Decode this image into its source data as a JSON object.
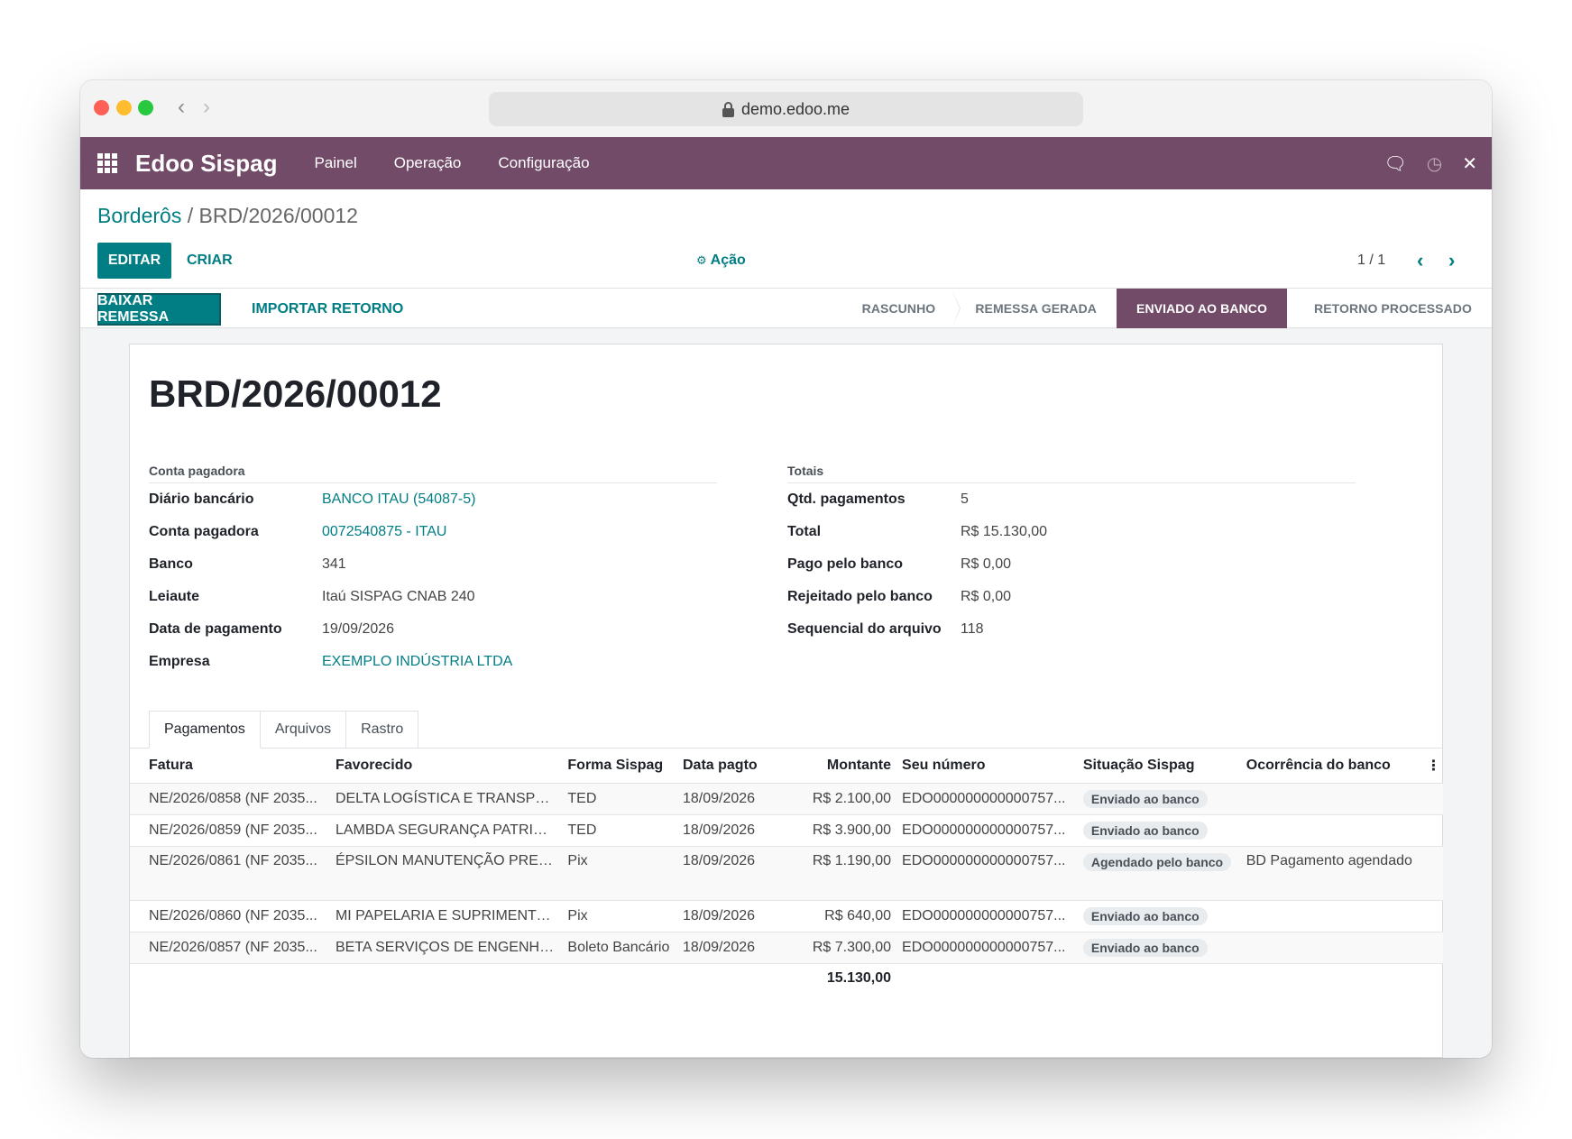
{
  "browser": {
    "url": "demo.edoo.me",
    "back_icon": "chevron-left",
    "forward_icon": "chevron-right"
  },
  "appbar": {
    "brand": "Edoo Sispag",
    "menu": [
      "Painel",
      "Operação",
      "Configuração"
    ],
    "bg_color": "#714b67"
  },
  "breadcrumb": {
    "parent": "Borderôs",
    "separator": "/",
    "current": "BRD/2026/00012"
  },
  "toolbar": {
    "edit_label": "EDITAR",
    "create_label": "CRIAR",
    "action_label": "Ação",
    "pager": "1 / 1"
  },
  "statusbar": {
    "download_label": "BAIXAR REMESSA",
    "import_label": "IMPORTAR RETORNO",
    "steps": [
      "RASCUNHO",
      "REMESSA GERADA",
      "ENVIADO AO BANCO",
      "RETORNO PROCESSADO"
    ],
    "active_step": "ENVIADO AO BANCO"
  },
  "record": {
    "title": "BRD/2026/00012",
    "left_group": {
      "title": "Conta pagadora",
      "fields": [
        {
          "label": "Diário bancário",
          "value": "BANCO ITAU (54087-5)"
        },
        {
          "label": "Conta pagadora",
          "value": "0072540875 - ITAU"
        },
        {
          "label": "Banco",
          "value": "341"
        },
        {
          "label": "Leiaute",
          "value": "Itaú SISPAG CNAB 240"
        },
        {
          "label": "Data de pagamento",
          "value": "19/09/2026"
        },
        {
          "label": "Empresa",
          "value": "EXEMPLO INDÚSTRIA LTDA"
        }
      ]
    },
    "right_group": {
      "title": "Totais",
      "fields": [
        {
          "label": "Qtd. pagamentos",
          "value": "5"
        },
        {
          "label": "Total",
          "value": "R$ 15.130,00"
        },
        {
          "label": "Pago pelo banco",
          "value": "R$ 0,00"
        },
        {
          "label": "Rejeitado pelo banco",
          "value": "R$ 0,00"
        },
        {
          "label": "Sequencial do arquivo",
          "value": "118"
        }
      ]
    }
  },
  "tabs": [
    "Pagamentos",
    "Arquivos",
    "Rastro"
  ],
  "table": {
    "headers": [
      "Fatura",
      "Favorecido",
      "Forma Sispag",
      "Data pagto",
      "Montante",
      "Seu número",
      "Situação Sispag",
      "Ocorrência do banco"
    ],
    "rows": [
      {
        "fatura": "NE/2026/0858 (NF 2035...",
        "favorecido": "DELTA LOGÍSTICA E TRANSPOR...",
        "forma": "TED",
        "data": "18/09/2026",
        "montante": "R$ 2.100,00",
        "seu_numero": "EDO000000000000757...",
        "situacao": "Enviado ao banco",
        "ocorrencia": ""
      },
      {
        "fatura": "NE/2026/0859 (NF 2035...",
        "favorecido": "LAMBDA SEGURANÇA PATRIM...",
        "forma": "TED",
        "data": "18/09/2026",
        "montante": "R$ 3.900,00",
        "seu_numero": "EDO000000000000757...",
        "situacao": "Enviado ao banco",
        "ocorrencia": ""
      },
      {
        "fatura": "NE/2026/0861 (NF 2035...",
        "favorecido": "ÉPSILON MANUTENÇÃO PREDI...",
        "forma": "Pix",
        "data": "18/09/2026",
        "montante": "R$ 1.190,00",
        "seu_numero": "EDO000000000000757...",
        "situacao": "Agendado pelo banco",
        "ocorrencia": "BD Pagamento agendado"
      },
      {
        "fatura": "NE/2026/0860 (NF 2035...",
        "favorecido": "MI PAPELARIA E SUPRIMENTO...",
        "forma": "Pix",
        "data": "18/09/2026",
        "montante": "R$ 640,00",
        "seu_numero": "EDO000000000000757...",
        "situacao": "Enviado ao banco",
        "ocorrencia": ""
      },
      {
        "fatura": "NE/2026/0857 (NF 2035...",
        "favorecido": "BETA SERVIÇOS DE ENGENHAR...",
        "forma": "Boleto Bancário",
        "data": "18/09/2026",
        "montante": "R$ 7.300,00",
        "seu_numero": "EDO000000000000757...",
        "situacao": "Enviado ao banco",
        "ocorrencia": ""
      }
    ],
    "total": "15.130,00"
  },
  "colors": {
    "primary": "#017e84",
    "brand": "#714b67"
  }
}
